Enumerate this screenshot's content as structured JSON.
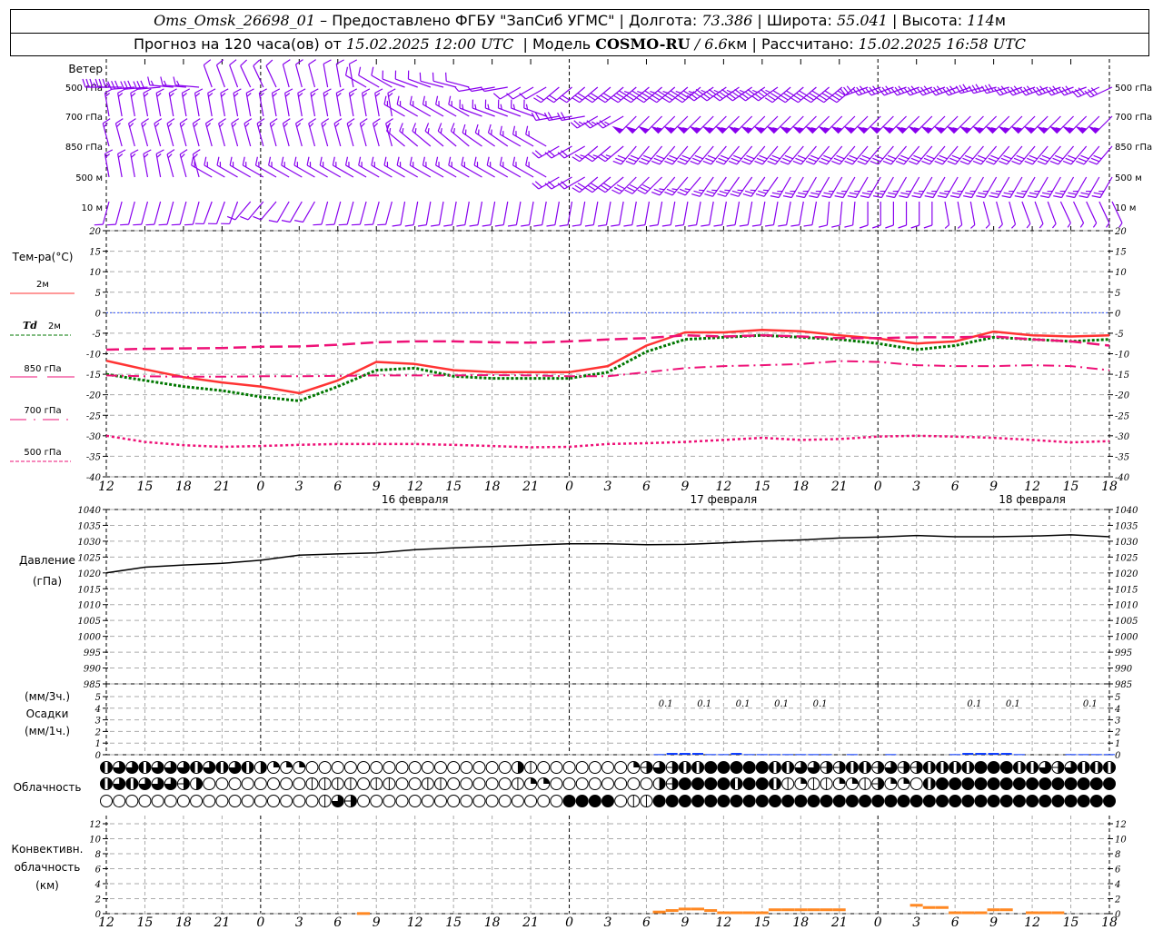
{
  "header": {
    "station": "Oms_Omsk_26698_01",
    "provider": "– Предоставлено ФГБУ \"ЗапСиб УГМС\"",
    "lon_label": "Долгота:",
    "lon": "73.386",
    "lat_label": "Широта:",
    "lat": "55.041",
    "elev_label": "Высота:",
    "elev": "114",
    "elev_unit": "м",
    "forecast_label": "Прогноз на 120 часа(ов) от",
    "forecast_time": "15.02.2025 12:00 UTC",
    "model_label": "Модель",
    "model": "COSMO-RU",
    "resolution": "6.6",
    "res_unit": "км",
    "computed_label": "Рассчитано:",
    "computed_time": "15.02.2025 16:58 UTC"
  },
  "colors": {
    "t2m": "#ff3333",
    "td2m": "#007700",
    "t850": "#ee1177",
    "t700": "#ee1177",
    "t500": "#ee1177",
    "wind": "#8800ee",
    "precip": "#0033ff",
    "convective": "#ff8822",
    "zero_line": "#3355ff",
    "grid": "#aaaaaa"
  },
  "labels": {
    "wind": "Ветер",
    "wind_levels": [
      "500 гПа",
      "700 гПа",
      "850 гПа",
      "500 м",
      "10   м"
    ],
    "temp_title": "Тем-ра(°C)",
    "t2m": "2м",
    "td_sym": "Td",
    "td2m": "2м",
    "t850": "850 гПа",
    "t700": "700 гПа",
    "t500": "500 гПа",
    "pressure": "Давление",
    "pressure_unit": "(гПа)",
    "precip3": "(мм/3ч.)",
    "precip": "Осадки",
    "precip1": "(мм/1ч.)",
    "cloud": "Облачность",
    "conv1": "Конвективн.",
    "conv2": "облачность",
    "conv3": "(км)"
  },
  "chart_data": {
    "type": "meteogram",
    "time_hours": [
      0,
      3,
      6,
      9,
      12,
      15,
      18,
      21,
      24,
      27,
      30,
      33,
      36,
      39,
      42,
      45,
      48,
      51,
      54,
      57,
      60,
      63,
      66,
      69,
      72,
      75,
      78
    ],
    "x_tick_labels": [
      "12",
      "15",
      "18",
      "21",
      "0",
      "3",
      "6",
      "9",
      "12",
      "15",
      "18",
      "21",
      "0",
      "3",
      "6",
      "9",
      "12",
      "15",
      "18",
      "21",
      "0",
      "3",
      "6",
      "9",
      "12",
      "15",
      "18"
    ],
    "day_labels": [
      {
        "hour": 24,
        "text": "16 февраля"
      },
      {
        "hour": 48,
        "text": "17 февраля"
      },
      {
        "hour": 72,
        "text": "18 февраля"
      }
    ],
    "wind": {
      "levels": [
        {
          "name": "500 гПа",
          "dir": [
            270,
            265,
            275,
            340,
            335,
            345,
            350,
            300,
            290,
            285,
            260,
            240,
            230,
            230,
            230,
            230,
            235,
            235,
            230,
            230,
            250,
            250,
            250,
            255,
            250,
            250,
            245
          ],
          "speed": [
            35,
            30,
            15,
            10,
            10,
            10,
            10,
            10,
            10,
            10,
            5,
            10,
            20,
            30,
            45,
            45,
            45,
            45,
            40,
            40,
            30,
            30,
            30,
            30,
            30,
            30,
            30
          ]
        },
        {
          "name": "700 гПа",
          "dir": [
            350,
            350,
            350,
            350,
            350,
            350,
            350,
            350,
            300,
            300,
            290,
            290,
            260,
            240,
            225,
            225,
            225,
            225,
            225,
            225,
            225,
            225,
            225,
            225,
            225,
            225,
            225
          ],
          "speed": [
            15,
            15,
            15,
            15,
            15,
            15,
            15,
            15,
            15,
            15,
            15,
            15,
            20,
            25,
            50,
            55,
            55,
            55,
            55,
            55,
            55,
            55,
            55,
            55,
            55,
            55,
            55
          ]
        },
        {
          "name": "850 гПа",
          "dir": [
            345,
            345,
            345,
            345,
            345,
            345,
            345,
            345,
            310,
            310,
            305,
            300,
            240,
            230,
            220,
            220,
            220,
            220,
            220,
            220,
            220,
            220,
            220,
            220,
            220,
            220,
            220
          ],
          "speed": [
            15,
            15,
            15,
            15,
            15,
            15,
            15,
            15,
            15,
            15,
            15,
            15,
            20,
            25,
            30,
            30,
            30,
            30,
            30,
            30,
            30,
            30,
            30,
            30,
            30,
            30,
            30
          ]
        },
        {
          "name": "500 м",
          "dir": [
            350,
            350,
            345,
            300,
            300,
            300,
            300,
            300,
            300,
            300,
            300,
            300,
            240,
            230,
            225,
            220,
            215,
            215,
            210,
            210,
            210,
            210,
            210,
            210,
            210,
            210,
            210
          ],
          "speed": [
            15,
            15,
            15,
            15,
            15,
            15,
            15,
            15,
            15,
            15,
            15,
            15,
            20,
            30,
            30,
            25,
            25,
            25,
            25,
            25,
            25,
            25,
            25,
            25,
            25,
            25,
            25
          ]
        },
        {
          "name": "10 м",
          "dir": [
            195,
            195,
            195,
            200,
            220,
            210,
            195,
            195,
            190,
            190,
            190,
            190,
            190,
            190,
            190,
            190,
            190,
            190,
            190,
            185,
            180,
            180,
            170,
            165,
            160,
            155,
            155
          ],
          "speed": [
            10,
            10,
            10,
            10,
            10,
            10,
            10,
            10,
            10,
            10,
            10,
            10,
            10,
            10,
            10,
            10,
            10,
            10,
            10,
            10,
            10,
            10,
            5,
            5,
            5,
            5,
            5
          ]
        }
      ]
    },
    "temperature": {
      "ylim": [
        -40,
        20
      ],
      "yticks": [
        20,
        15,
        10,
        5,
        0,
        -5,
        -10,
        -15,
        -20,
        -25,
        -30,
        -35,
        -40
      ],
      "series": [
        {
          "name": "2м",
          "key": "t2m",
          "values": [
            -11.7,
            -13.8,
            -15.7,
            -17,
            -18,
            -19.6,
            -16.5,
            -12,
            -12.5,
            -14,
            -14.5,
            -14.5,
            -14.5,
            -13,
            -8,
            -4.8,
            -4.8,
            -4.2,
            -4.5,
            -5.5,
            -6.3,
            -7.5,
            -7,
            -4.6,
            -5.5,
            -5.8,
            -5.5
          ]
        },
        {
          "name": "Td 2м",
          "key": "td2m",
          "values": [
            -15,
            -16.5,
            -18,
            -19,
            -20.5,
            -21.5,
            -18,
            -14,
            -13.5,
            -15.5,
            -16,
            -16,
            -16,
            -14.5,
            -9.5,
            -6.5,
            -6,
            -5.5,
            -6,
            -6.5,
            -7.5,
            -9,
            -8,
            -6,
            -6.5,
            -7,
            -6.5
          ]
        },
        {
          "name": "850 гПа",
          "key": "t850",
          "values": [
            -9,
            -8.8,
            -8.7,
            -8.6,
            -8.3,
            -8.2,
            -7.8,
            -7.2,
            -7,
            -7,
            -7.2,
            -7.3,
            -7,
            -6.5,
            -6.2,
            -5.5,
            -5.8,
            -5.5,
            -5.8,
            -6.2,
            -6.2,
            -6,
            -6,
            -5.8,
            -6.5,
            -7,
            -8
          ]
        },
        {
          "name": "700 гПа",
          "key": "t700",
          "values": [
            -15.3,
            -15.5,
            -15.6,
            -15.6,
            -15.5,
            -15.5,
            -15.4,
            -15.3,
            -15.3,
            -15.3,
            -15.2,
            -15.3,
            -15.5,
            -15.5,
            -14.5,
            -13.5,
            -13,
            -12.8,
            -12.5,
            -11.8,
            -12,
            -12.8,
            -13,
            -13,
            -12.8,
            -13,
            -14
          ]
        },
        {
          "name": "500 гПа",
          "key": "t500",
          "values": [
            -30,
            -31.5,
            -32.3,
            -32.7,
            -32.5,
            -32.2,
            -32,
            -32,
            -32,
            -32.2,
            -32.5,
            -32.8,
            -32.7,
            -32,
            -31.8,
            -31.5,
            -31,
            -30.5,
            -31,
            -30.8,
            -30.2,
            -30,
            -30.2,
            -30.5,
            -31,
            -31.6,
            -31.3
          ]
        }
      ]
    },
    "pressure": {
      "ylim": [
        985,
        1040
      ],
      "yticks": [
        1040,
        1035,
        1030,
        1025,
        1020,
        1015,
        1010,
        1005,
        1000,
        995,
        990,
        985
      ],
      "values": [
        1020,
        1021.8,
        1022.5,
        1023,
        1024,
        1025.6,
        1026,
        1026.3,
        1027.3,
        1027.9,
        1028.3,
        1028.8,
        1029.2,
        1029.2,
        1028.9,
        1029,
        1029.5,
        1030,
        1030.4,
        1031,
        1031.3,
        1031.8,
        1031.4,
        1031.4,
        1031.6,
        1032,
        1031.4
      ]
    },
    "precipitation": {
      "ylim": [
        0,
        5
      ],
      "yticks": [
        5,
        4,
        3,
        2,
        1,
        0
      ],
      "hourly": [
        {
          "hour": 43,
          "value": 0.05
        },
        {
          "hour": 44,
          "value": 0.15
        },
        {
          "hour": 45,
          "value": 0.15
        },
        {
          "hour": 46,
          "value": 0.15
        },
        {
          "hour": 47,
          "value": 0.05
        },
        {
          "hour": 48,
          "value": 0.05
        },
        {
          "hour": 49,
          "value": 0.15
        },
        {
          "hour": 50,
          "value": 0.05
        },
        {
          "hour": 51,
          "value": 0.05
        },
        {
          "hour": 52,
          "value": 0.05
        },
        {
          "hour": 53,
          "value": 0.05
        },
        {
          "hour": 54,
          "value": 0.05
        },
        {
          "hour": 55,
          "value": 0.05
        },
        {
          "hour": 56,
          "value": 0.05
        },
        {
          "hour": 58,
          "value": 0.05
        },
        {
          "hour": 61,
          "value": 0.05
        },
        {
          "hour": 66,
          "value": 0.05
        },
        {
          "hour": 67,
          "value": 0.15
        },
        {
          "hour": 68,
          "value": 0.15
        },
        {
          "hour": 69,
          "value": 0.15
        },
        {
          "hour": 70,
          "value": 0.15
        },
        {
          "hour": 71,
          "value": 0.05
        },
        {
          "hour": 75,
          "value": 0.05
        },
        {
          "hour": 76,
          "value": 0.05
        },
        {
          "hour": 77,
          "value": 0.05
        },
        {
          "hour": 78,
          "value": 0.05
        }
      ],
      "sums_3h": [
        {
          "hour": 43.5,
          "text": "0.1"
        },
        {
          "hour": 46.5,
          "text": "0.1"
        },
        {
          "hour": 49.5,
          "text": "0.1"
        },
        {
          "hour": 52.5,
          "text": "0.1"
        },
        {
          "hour": 55.5,
          "text": "0.1"
        },
        {
          "hour": 67.5,
          "text": "0.1"
        },
        {
          "hour": 70.5,
          "text": "0.1"
        },
        {
          "hour": 76.5,
          "text": "0.1"
        }
      ]
    },
    "cloud_octas": {
      "high": [
        7,
        6,
        6,
        7,
        6,
        6,
        6,
        7,
        6,
        7,
        6,
        7,
        4,
        2,
        2,
        2,
        0,
        0,
        0,
        0,
        0,
        0,
        0,
        0,
        0,
        0,
        0,
        0,
        0,
        0,
        0,
        0,
        4,
        1,
        0,
        0,
        0,
        0,
        0,
        0,
        0,
        2,
        5,
        6,
        5,
        7,
        7,
        8,
        8,
        8,
        8,
        8,
        7,
        7,
        6,
        6,
        5,
        5,
        7,
        7,
        5,
        6,
        5,
        5,
        7,
        7,
        7,
        7,
        8,
        8,
        8,
        7,
        7,
        6,
        5,
        6,
        7,
        7,
        7
      ],
      "middle": [
        7,
        6,
        7,
        6,
        6,
        6,
        5,
        4,
        0,
        0,
        0,
        0,
        0,
        0,
        0,
        0,
        1,
        1,
        1,
        1,
        0,
        1,
        1,
        0,
        0,
        1,
        1,
        0,
        0,
        0,
        0,
        0,
        1,
        2,
        2,
        0,
        0,
        0,
        0,
        0,
        0,
        0,
        0,
        4,
        5,
        8,
        8,
        8,
        8,
        7,
        8,
        8,
        7,
        1,
        2,
        1,
        1,
        2,
        2,
        1,
        5,
        2,
        2,
        0,
        7,
        8,
        8,
        8,
        8,
        8,
        8,
        8,
        8,
        8,
        8,
        8,
        8,
        8,
        8
      ],
      "low": [
        0,
        0,
        0,
        0,
        0,
        0,
        0,
        0,
        0,
        0,
        0,
        0,
        0,
        0,
        0,
        0,
        0,
        1,
        6,
        5,
        0,
        0,
        0,
        0,
        0,
        0,
        0,
        0,
        0,
        0,
        0,
        0,
        0,
        0,
        0,
        0,
        8,
        8,
        8,
        8,
        0,
        1,
        1,
        8,
        8,
        8,
        8,
        8,
        8,
        8,
        8,
        8,
        8,
        8,
        8,
        8,
        8,
        8,
        8,
        8,
        8,
        8,
        8,
        8,
        8,
        8,
        8,
        8,
        8,
        8,
        8,
        8,
        8,
        8,
        8,
        8,
        8,
        8,
        8
      ]
    },
    "convective_cloud": {
      "ylim": [
        0,
        13
      ],
      "yticks": [
        12,
        10,
        8,
        6,
        4,
        2,
        0
      ],
      "hourly_top_km": [
        {
          "hour": 20,
          "value": 0.2
        },
        {
          "hour": 43,
          "value": 0.4
        },
        {
          "hour": 44,
          "value": 0.6
        },
        {
          "hour": 45,
          "value": 0.8
        },
        {
          "hour": 46,
          "value": 0.8
        },
        {
          "hour": 47,
          "value": 0.6
        },
        {
          "hour": 48,
          "value": 0.3
        },
        {
          "hour": 49,
          "value": 0.3
        },
        {
          "hour": 50,
          "value": 0.3
        },
        {
          "hour": 51,
          "value": 0.3
        },
        {
          "hour": 52,
          "value": 0.7
        },
        {
          "hour": 53,
          "value": 0.7
        },
        {
          "hour": 54,
          "value": 0.7
        },
        {
          "hour": 55,
          "value": 0.7
        },
        {
          "hour": 56,
          "value": 0.7
        },
        {
          "hour": 57,
          "value": 0.7
        },
        {
          "hour": 63,
          "value": 1.3
        },
        {
          "hour": 64,
          "value": 1.0
        },
        {
          "hour": 65,
          "value": 1.0
        },
        {
          "hour": 66,
          "value": 0.3
        },
        {
          "hour": 67,
          "value": 0.3
        },
        {
          "hour": 68,
          "value": 0.3
        },
        {
          "hour": 69,
          "value": 0.7
        },
        {
          "hour": 70,
          "value": 0.7
        },
        {
          "hour": 72,
          "value": 0.3
        },
        {
          "hour": 73,
          "value": 0.3
        },
        {
          "hour": 74,
          "value": 0.3
        }
      ]
    }
  }
}
